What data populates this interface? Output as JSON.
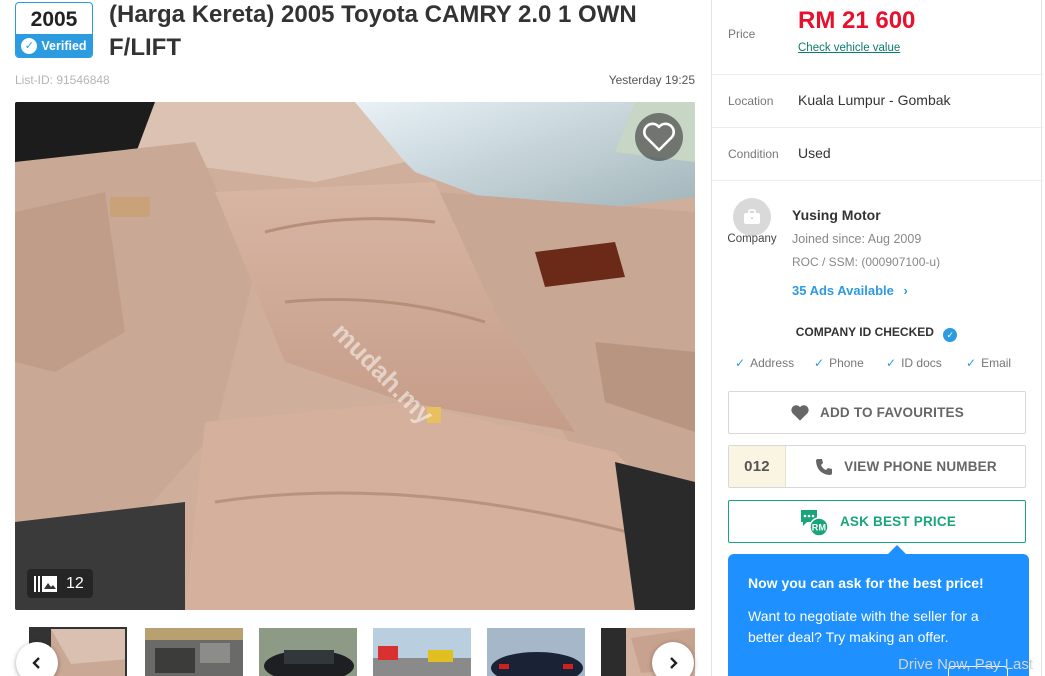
{
  "header": {
    "year": "2005",
    "verified_label": "Verified",
    "title": "(Harga Kereta) 2005 Toyota CAMRY 2.0 1 OWN F/LIFT",
    "list_id": "List-ID: 91546848",
    "posted": "Yesterday 19:25"
  },
  "gallery": {
    "image_count": "12",
    "watermark": "mudah.my"
  },
  "details": {
    "price_label": "Price",
    "price": "RM 21 600",
    "check_value_link": "Check vehicle value",
    "location_label": "Location",
    "location": "Kuala Lumpur - Gombak",
    "condition_label": "Condition",
    "condition": "Used"
  },
  "seller": {
    "type": "Company",
    "name": "Yusing Motor",
    "joined": "Joined since: Aug 2009",
    "roc": "ROC / SSM: (000907100-u)",
    "ads_link": "35 Ads Available"
  },
  "verification": {
    "title": "COMPANY ID CHECKED",
    "items": [
      "Address",
      "Phone",
      "ID docs",
      "Email"
    ]
  },
  "actions": {
    "favourite": "ADD TO FAVOURITES",
    "phone_prefix": "012",
    "view_phone": "VIEW PHONE NUMBER",
    "ask_price": "ASK BEST PRICE"
  },
  "tooltip": {
    "title": "Now you can ask for the best price!",
    "body": "Want to negotiate with the seller for a better deal? Try making an offer."
  },
  "footer": {
    "faded_link": "Drive Now, Pay Last"
  },
  "colors": {
    "accent_blue": "#2d9be0",
    "price_red": "#e8112d",
    "ask_green": "#19a57a",
    "tooltip_blue": "#1e90ff"
  }
}
